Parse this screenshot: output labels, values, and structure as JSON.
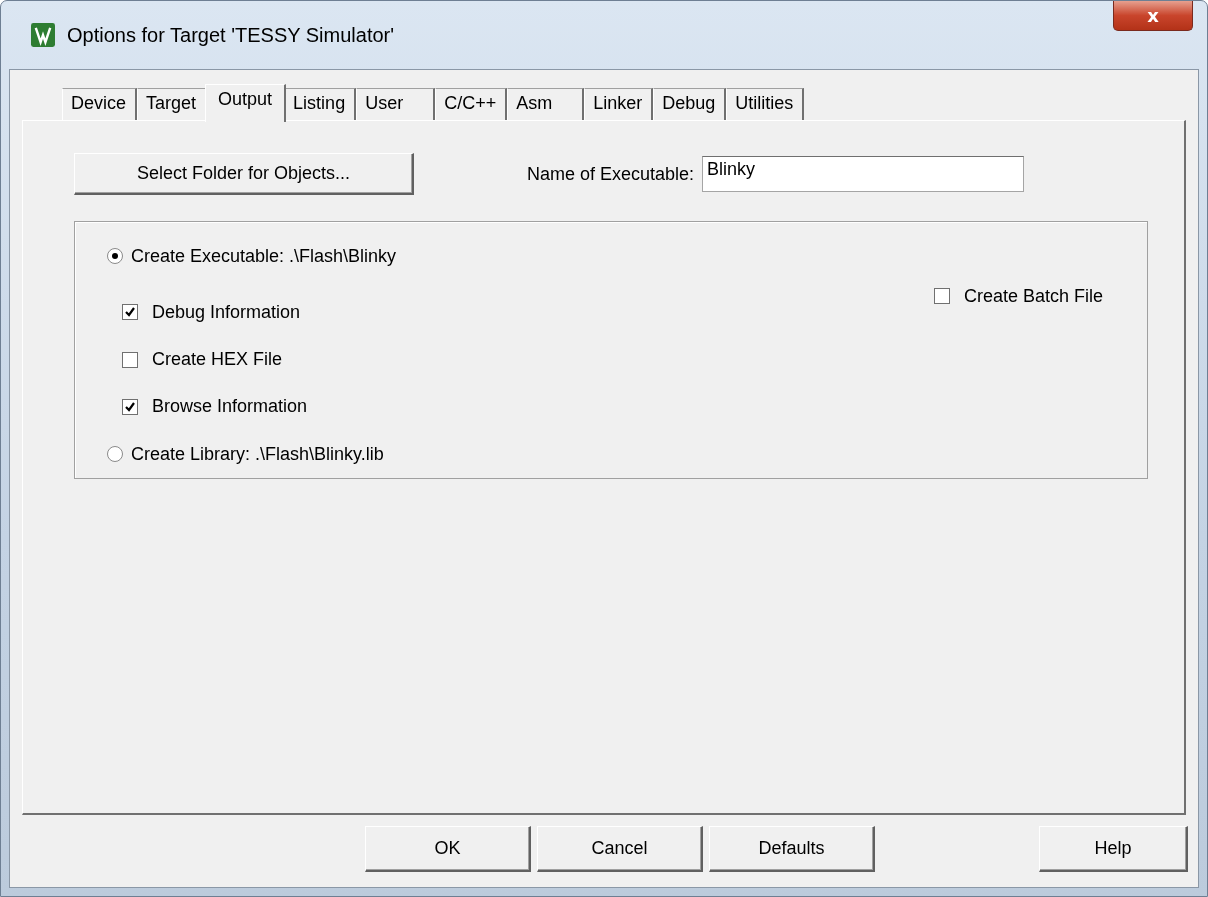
{
  "window": {
    "title": "Options for Target 'TESSY Simulator'",
    "close": "x"
  },
  "tabs": [
    {
      "label": "Device",
      "selected": false
    },
    {
      "label": "Target",
      "selected": false
    },
    {
      "label": "Output",
      "selected": true
    },
    {
      "label": "Listing",
      "selected": false
    },
    {
      "label": "User",
      "selected": false
    },
    {
      "label": "C/C++",
      "selected": false
    },
    {
      "label": "Asm",
      "selected": false
    },
    {
      "label": "Linker",
      "selected": false
    },
    {
      "label": "Debug",
      "selected": false
    },
    {
      "label": "Utilities",
      "selected": false
    }
  ],
  "select_folder_button": "Select Folder for Objects...",
  "executable_name": {
    "label": "Name of Executable:",
    "value": "Blinky"
  },
  "output_options": [
    {
      "kind": "radio",
      "label": "Create Executable:  .\\Flash\\Blinky",
      "selected": true
    },
    {
      "kind": "checkbox",
      "label": "Debug Information",
      "checked": true
    },
    {
      "kind": "checkbox",
      "label": "Create HEX File",
      "checked": false
    },
    {
      "kind": "checkbox",
      "label": "Browse Information",
      "checked": true
    },
    {
      "kind": "radio",
      "label": "Create Library:  .\\Flash\\Blinky.lib",
      "selected": false
    }
  ],
  "batch_file": {
    "label": "Create Batch File",
    "checked": false
  },
  "buttons": [
    "OK",
    "Cancel",
    "Defaults"
  ],
  "help_button": "Help"
}
